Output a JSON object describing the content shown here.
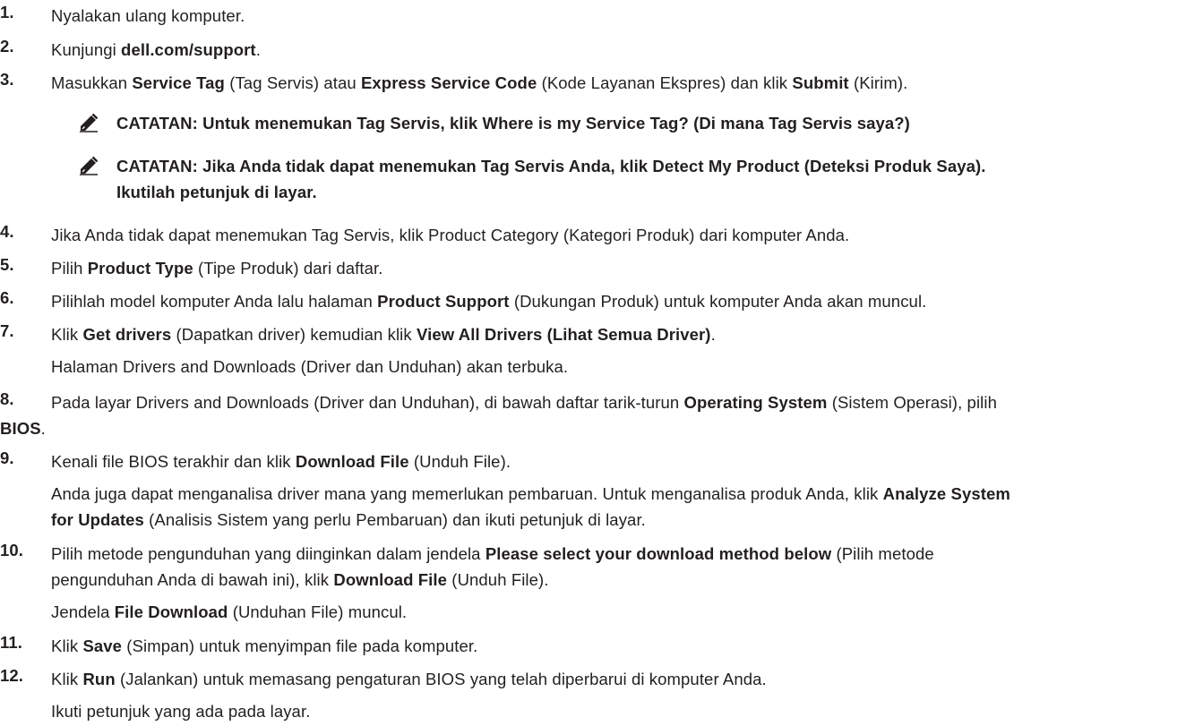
{
  "steps": [
    {
      "num": "1.",
      "parts": [
        {
          "t": "Nyalakan ulang komputer."
        }
      ]
    },
    {
      "num": "2.",
      "parts": [
        {
          "t": "Kunjungi "
        },
        {
          "t": "dell.com/support",
          "b": true
        },
        {
          "t": "."
        }
      ]
    },
    {
      "num": "3.",
      "parts": [
        {
          "t": "Masukkan "
        },
        {
          "t": "Service Tag",
          "b": true
        },
        {
          "t": " (Tag Servis) atau "
        },
        {
          "t": "Express Service Code",
          "b": true
        },
        {
          "t": " (Kode Layanan Ekspres) dan klik "
        },
        {
          "t": "Submit",
          "b": true
        },
        {
          "t": " (Kirim)."
        }
      ]
    },
    {
      "num": "4.",
      "parts": [
        {
          "t": "Jika Anda tidak dapat menemukan Tag Servis, klik Product Category (Kategori Produk) dari komputer Anda."
        }
      ]
    },
    {
      "num": "5.",
      "parts": [
        {
          "t": "Pilih "
        },
        {
          "t": "Product Type",
          "b": true
        },
        {
          "t": " (Tipe Produk) dari daftar."
        }
      ]
    },
    {
      "num": "6.",
      "parts": [
        {
          "t": "Pilihlah model komputer Anda lalu halaman "
        },
        {
          "t": "Product Support",
          "b": true
        },
        {
          "t": " (Dukungan Produk) untuk komputer Anda akan muncul."
        }
      ]
    },
    {
      "num": "7.",
      "parts": [
        {
          "t": "Klik "
        },
        {
          "t": "Get drivers",
          "b": true
        },
        {
          "t": " (Dapatkan driver) kemudian klik "
        },
        {
          "t": "View All Drivers (Lihat Semua Driver)",
          "b": true
        },
        {
          "t": "."
        }
      ],
      "sub": "Halaman Drivers and Downloads (Driver dan Unduhan) akan terbuka."
    },
    {
      "num": "8.",
      "lines": [
        [
          {
            "t": "Pada layar Drivers and Downloads (Driver dan Unduhan), di bawah daftar tarik-turun "
          },
          {
            "t": "Operating System",
            "b": true
          },
          {
            "t": " (Sistem Operasi), pilih"
          }
        ],
        [
          {
            "t": "BIOS",
            "b": true
          },
          {
            "t": "."
          }
        ]
      ]
    },
    {
      "num": "9.",
      "parts": [
        {
          "t": "Kenali file BIOS terakhir dan klik "
        },
        {
          "t": "Download File",
          "b": true
        },
        {
          "t": " (Unduh File)."
        }
      ],
      "sublines": [
        [
          {
            "t": "Anda juga dapat menganalisa driver mana yang memerlukan pembaruan. Untuk menganalisa produk Anda, klik "
          },
          {
            "t": "Analyze System",
            "b": true
          }
        ],
        [
          {
            "t": "for Updates",
            "b": true
          },
          {
            "t": " (Analisis Sistem yang perlu Pembaruan) dan ikuti petunjuk di layar."
          }
        ]
      ]
    },
    {
      "num": "10.",
      "lines": [
        [
          {
            "t": "Pilih metode pengunduhan yang diinginkan dalam jendela "
          },
          {
            "t": "Please select your download method below",
            "b": true
          },
          {
            "t": " (Pilih metode"
          }
        ],
        [
          {
            "t": "pengunduhan Anda di bawah ini), klik "
          },
          {
            "t": "Download File",
            "b": true
          },
          {
            "t": " (Unduh File)."
          }
        ]
      ],
      "sublines": [
        [
          {
            "t": "Jendela "
          },
          {
            "t": "File Download",
            "b": true
          },
          {
            "t": " (Unduhan File) muncul."
          }
        ]
      ]
    },
    {
      "num": "11.",
      "parts": [
        {
          "t": "Klik "
        },
        {
          "t": "Save",
          "b": true
        },
        {
          "t": " (Simpan) untuk menyimpan file pada komputer."
        }
      ]
    },
    {
      "num": "12.",
      "parts": [
        {
          "t": "Klik "
        },
        {
          "t": "Run",
          "b": true
        },
        {
          "t": " (Jalankan) untuk memasang pengaturan BIOS yang telah diperbarui di komputer Anda."
        }
      ],
      "sub": "Ikuti petunjuk yang ada pada layar."
    }
  ],
  "notes": [
    {
      "lines": [
        "CATATAN: Untuk menemukan Tag Servis, klik Where is my Service Tag? (Di mana Tag Servis saya?)"
      ]
    },
    {
      "lines": [
        "CATATAN: Jika Anda tidak dapat menemukan Tag Servis Anda, klik Detect My Product (Deteksi Produk Saya).",
        "Ikutilah petunjuk di layar."
      ]
    }
  ],
  "icons": {
    "note": "pencil-note-icon"
  }
}
